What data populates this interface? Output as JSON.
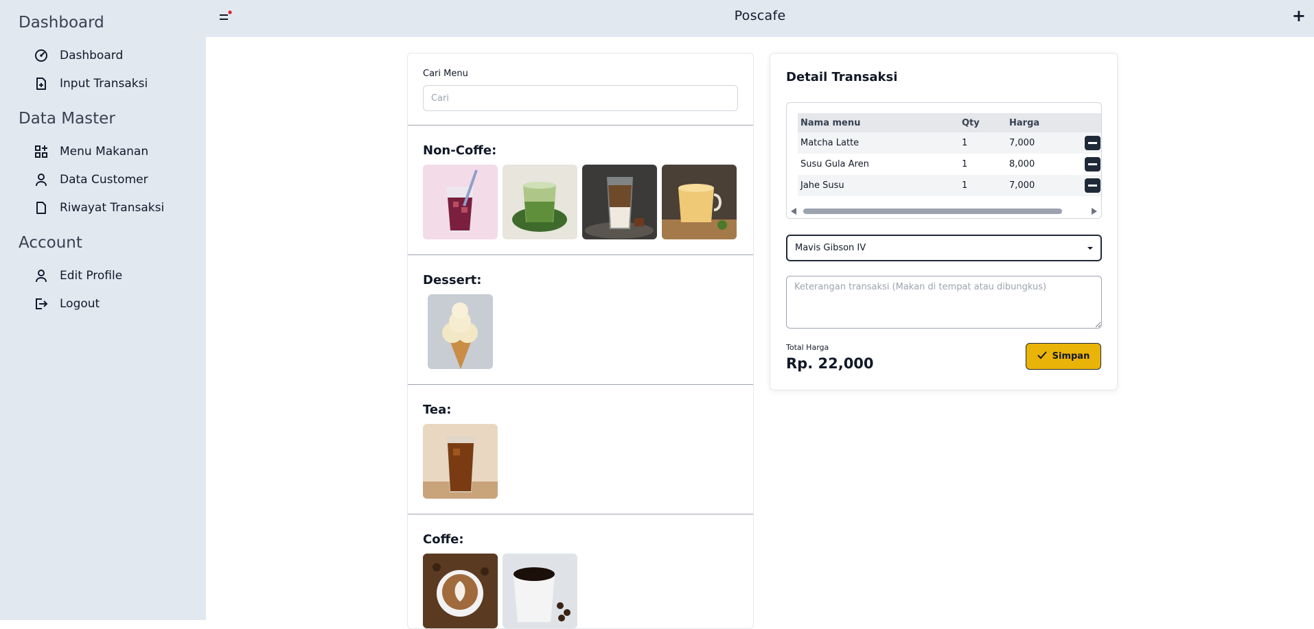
{
  "app": {
    "title": "Poscafe"
  },
  "sidebar": {
    "sections": [
      {
        "title": "Dashboard",
        "items": [
          {
            "label": "Dashboard",
            "icon": "gauge-icon"
          },
          {
            "label": "Input Transaksi",
            "icon": "file-plus-icon"
          }
        ]
      },
      {
        "title": "Data Master",
        "items": [
          {
            "label": "Menu Makanan",
            "icon": "grid-plus-icon"
          },
          {
            "label": "Data Customer",
            "icon": "user-icon"
          },
          {
            "label": "Riwayat Transaksi",
            "icon": "file-icon"
          }
        ]
      },
      {
        "title": "Account",
        "items": [
          {
            "label": "Edit Profile",
            "icon": "user-icon"
          },
          {
            "label": "Logout",
            "icon": "logout-icon"
          }
        ]
      }
    ]
  },
  "topbar": {
    "plus": "+"
  },
  "menu": {
    "search_label": "Cari Menu",
    "search_placeholder": "Cari",
    "categories": [
      {
        "title": "Non-Coffe:",
        "items": [
          "iced-berry-drink",
          "matcha-drink",
          "iced-latte",
          "milk-tea"
        ]
      },
      {
        "title": "Dessert:",
        "items": [
          "ice-cream-cone"
        ]
      },
      {
        "title": "Tea:",
        "items": [
          "iced-tea"
        ]
      },
      {
        "title": "Coffe:",
        "items": [
          "latte-art",
          "black-coffee"
        ]
      }
    ]
  },
  "detail": {
    "title": "Detail Transaksi",
    "columns": {
      "name": "Nama menu",
      "qty": "Qty",
      "price": "Harga"
    },
    "rows": [
      {
        "name": "Matcha Latte",
        "qty": "1",
        "price": "7,000"
      },
      {
        "name": "Susu Gula Aren",
        "qty": "1",
        "price": "8,000"
      },
      {
        "name": "Jahe Susu",
        "qty": "1",
        "price": "7,000"
      }
    ],
    "customer": "Mavis Gibson IV",
    "note_placeholder": "Keterangan transaksi (Makan di tempat atau dibungkus)",
    "total_label": "Total Harga",
    "total_value": "Rp. 22,000",
    "save_label": "Simpan"
  },
  "colors": {
    "sidebar_bg": "#e2e8f0",
    "accent": "#eab308",
    "dark": "#1f2937",
    "notification_dot": "#dc2626"
  }
}
